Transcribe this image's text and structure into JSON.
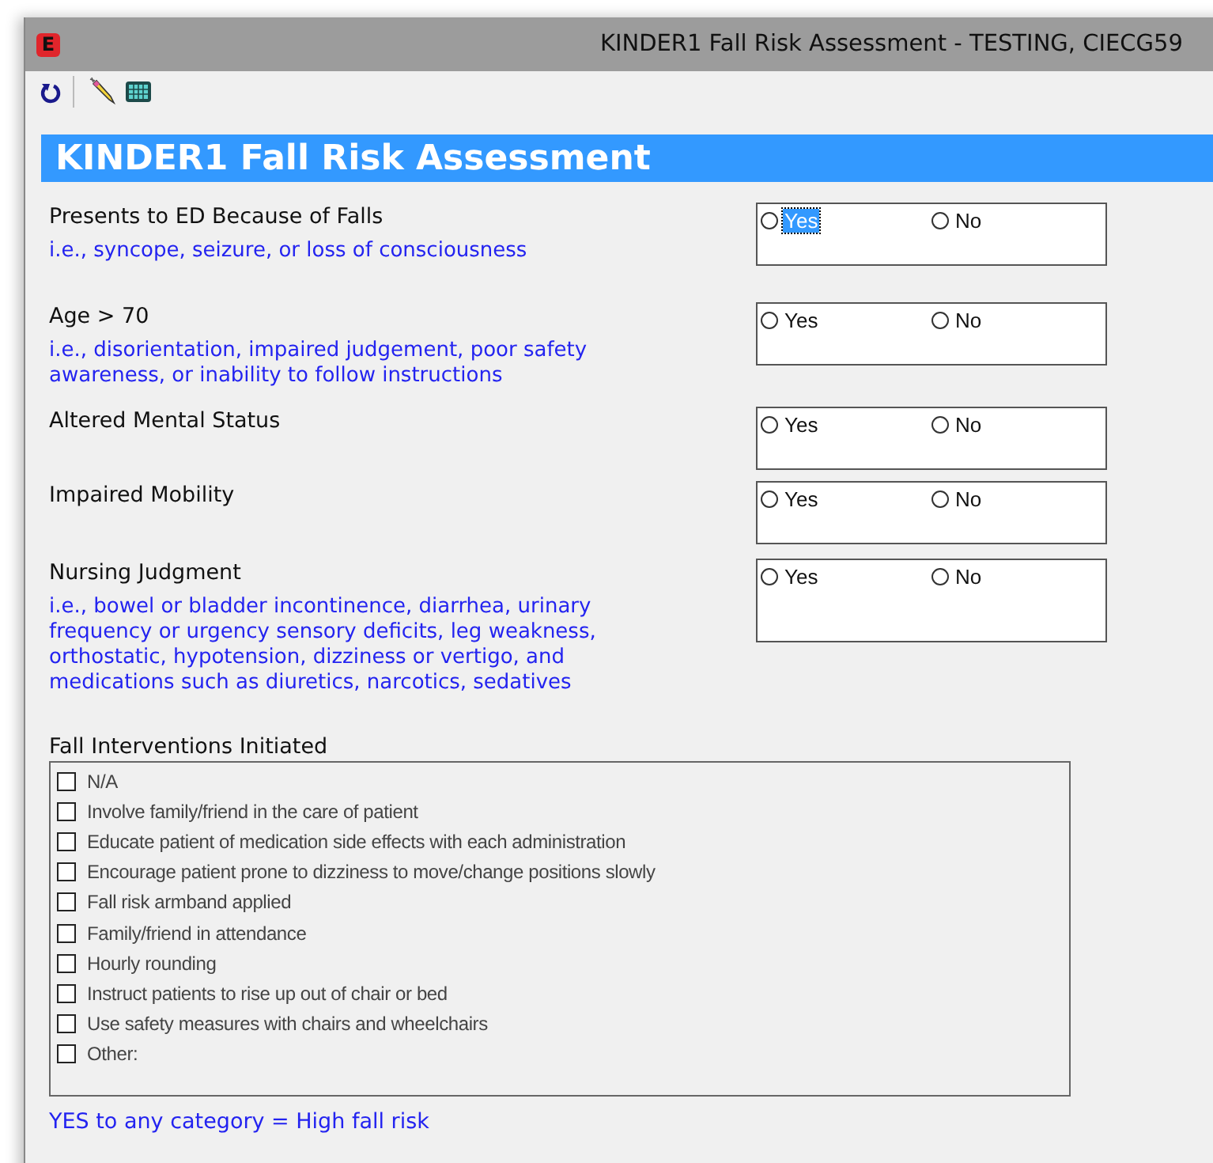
{
  "window": {
    "title": "KINDER1 Fall Risk Assessment - TESTING, CIECG59",
    "app_icon": "E"
  },
  "form": {
    "heading": "KINDER1 Fall Risk Assessment",
    "questions": [
      {
        "label": "Presents to ED Because of Falls",
        "hint": "i.e., syncope, seizure, or loss of consciousness",
        "options": [
          {
            "label": "Yes",
            "selected": false,
            "focused": true
          },
          {
            "label": "No",
            "selected": false,
            "focused": false
          }
        ]
      },
      {
        "label": "Age > 70",
        "hint": "i.e., disorientation, impaired judgement, poor safety awareness, or inability to follow instructions",
        "options": [
          {
            "label": "Yes",
            "selected": false,
            "focused": false
          },
          {
            "label": "No",
            "selected": false,
            "focused": false
          }
        ]
      },
      {
        "label": "Altered Mental Status",
        "options": [
          {
            "label": "Yes",
            "selected": false,
            "focused": false
          },
          {
            "label": "No",
            "selected": false,
            "focused": false
          }
        ]
      },
      {
        "label": "Impaired Mobility",
        "options": [
          {
            "label": "Yes",
            "selected": false,
            "focused": false
          },
          {
            "label": "No",
            "selected": false,
            "focused": false
          }
        ]
      },
      {
        "label": "Nursing Judgment",
        "hint": "i.e., bowel or bladder incontinence, diarrhea, urinary frequency or urgency sensory deficits, leg weakness, orthostatic, hypotension, dizziness or vertigo, and medications such as diuretics, narcotics, sedatives",
        "options": [
          {
            "label": "Yes",
            "selected": false,
            "focused": false
          },
          {
            "label": "No",
            "selected": false,
            "focused": false
          }
        ]
      }
    ],
    "interventions": {
      "label": "Fall Interventions Initiated",
      "items": [
        {
          "label": "N/A",
          "checked": false
        },
        {
          "label": "Involve family/friend in the care of patient",
          "checked": false
        },
        {
          "label": "Educate patient of medication side effects with each administration",
          "checked": false
        },
        {
          "label": "Encourage patient prone to dizziness to move/change positions slowly",
          "checked": false
        },
        {
          "label": "Fall risk armband applied",
          "checked": false
        },
        {
          "label": "Family/friend in attendance",
          "checked": false
        },
        {
          "label": "Hourly rounding",
          "checked": false
        },
        {
          "label": "Instruct patients to rise up out of chair or bed",
          "checked": false
        },
        {
          "label": "Use safety measures with chairs and wheelchairs",
          "checked": false
        },
        {
          "label": "Other:",
          "checked": false
        }
      ]
    },
    "footer_note": "YES to any category = High fall risk"
  }
}
